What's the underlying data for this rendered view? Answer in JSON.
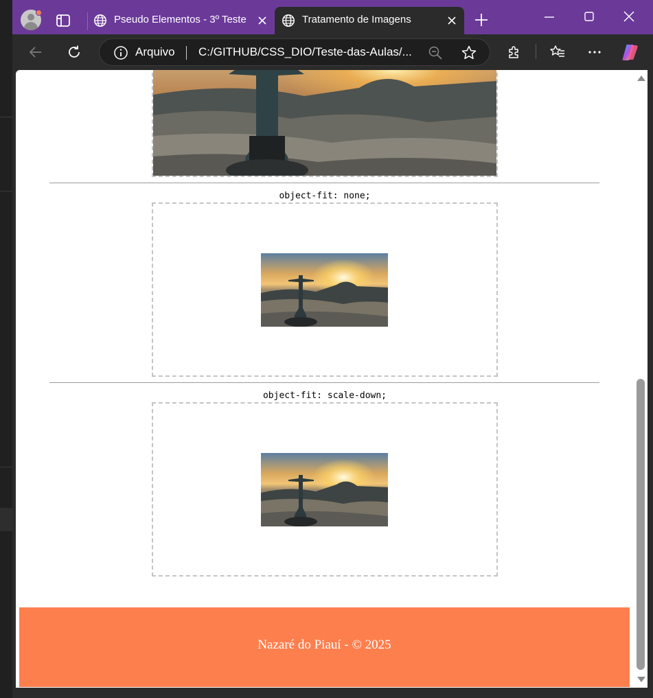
{
  "browser": {
    "tabs": [
      {
        "title": "Pseudo Elementos - 3º Teste",
        "active": false
      },
      {
        "title": "Tratamento de Imagens",
        "active": true
      }
    ],
    "address": {
      "scheme_label": "Arquivo",
      "url": "C:/GITHUB/CSS_DIO/Teste-das-Aulas/..."
    }
  },
  "page": {
    "sections": [
      {
        "caption": "object-fit: none;"
      },
      {
        "caption": "object-fit: scale-down;"
      }
    ],
    "footer": "Nazaré do Piauí - © 2025"
  },
  "colors": {
    "titlebar": "#6b3a99",
    "toolbar": "#2b2b2b",
    "footer": "#fe7f4e",
    "frame_border": "#c4c4c4"
  },
  "icons": [
    "profile-icon",
    "tab-actions-icon",
    "globe-icon",
    "close-icon",
    "new-tab-icon",
    "minimize-icon",
    "maximize-icon",
    "window-close-icon",
    "back-icon",
    "refresh-icon",
    "info-icon",
    "zoom-out-icon",
    "favorite-star-icon",
    "extensions-icon",
    "favorites-icon",
    "more-icon",
    "copilot-icon"
  ]
}
